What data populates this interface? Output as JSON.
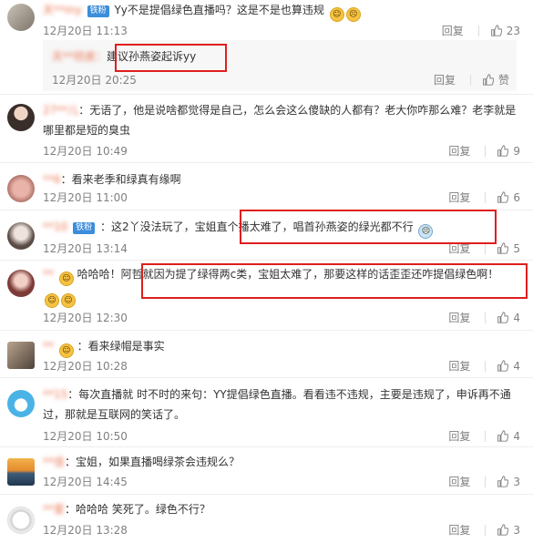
{
  "comments": [
    {
      "user": "天**my",
      "badge": "铁粉",
      "text": "Yy不是提倡绿色直播吗？这是不是也算违规",
      "emoji": "😅🙁",
      "time": "12月20日 11:13",
      "reply": "回复",
      "likes": "23"
    },
    {
      "user": "天**欣皮：",
      "text": "建议孙燕姿起诉yy",
      "time": "12月20日 20:25",
      "reply": "回复",
      "likes": "赞"
    },
    {
      "user": "27**儿",
      "text": "：无语了，他是说啥都觉得是自己，怎么会这么傻缺的人都有？老大你咋那么难？老李就是哪里都是短的臭虫",
      "time": "12月20日 10:49",
      "reply": "回复",
      "likes": "9"
    },
    {
      "user": "**6",
      "text": "：看来老季和绿真有缘啊",
      "time": "12月20日 11:00",
      "reply": "回复",
      "likes": "6"
    },
    {
      "user": "**10",
      "badge": "铁粉",
      "text": "：这2丫没法玩了，宝姐直个播太难了，唱首孙燕姿的绿光都不行",
      "time": "12月20日 13:14",
      "reply": "回复",
      "likes": "5"
    },
    {
      "user": "**",
      "text": "哈哈哈！阿哲就因为提了绿得两c类，宝姐太难了，那要这样的话歪歪还咋提倡绿色啊！",
      "time": "12月20日 12:30",
      "reply": "回复",
      "likes": "4"
    },
    {
      "user": "**",
      "text": "：看来绿帽是事实",
      "time": "12月20日 10:28",
      "reply": "回复",
      "likes": "4"
    },
    {
      "user": "**15",
      "text": "：每次直播就 时不时的来句：YY提倡绿色直播。看看违不违规，主要是违规了，申诉再不通过，那就是互联网的笑话了。",
      "time": "12月20日 10:50",
      "reply": "回复",
      "likes": "4"
    },
    {
      "user": "**佳",
      "text": "：宝姐，如果直播喝绿茶会违规么？",
      "time": "12月20日 14:45",
      "reply": "回复",
      "likes": "3"
    },
    {
      "user": "**爱",
      "text": "：哈哈哈 笑死了。绿色不行？",
      "time": "12月20日 13:28",
      "reply": "回复",
      "likes": "3"
    }
  ],
  "colors": {
    "username": "#eb7350",
    "meta": "#808080",
    "highlight": "#e01e1e"
  }
}
